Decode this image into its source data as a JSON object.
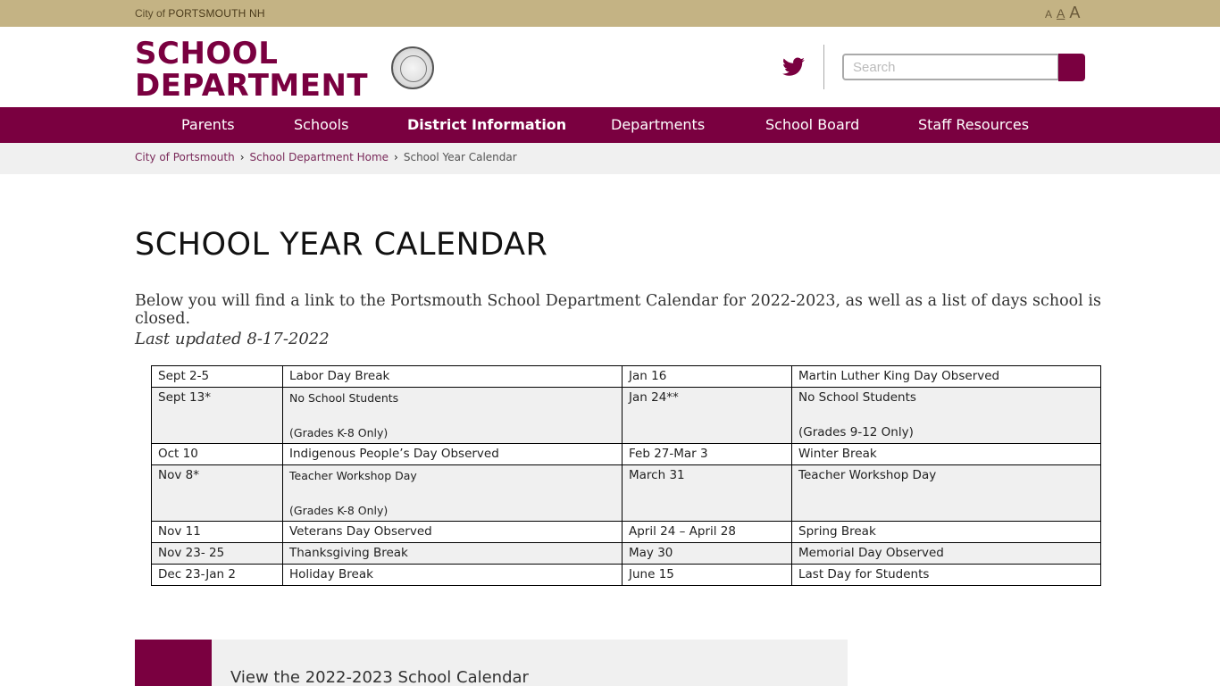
{
  "topbar": {
    "city_prefix": "City of",
    "city_name": "PORTSMOUTH NH",
    "font_sizes": [
      "A",
      "A",
      "A"
    ]
  },
  "header": {
    "logo_line1": "SCHOOL",
    "logo_line2": "DEPARTMENT",
    "search_placeholder": "Search"
  },
  "nav": {
    "items": [
      {
        "label": "Parents"
      },
      {
        "label": "Schools"
      },
      {
        "label": "District Information"
      },
      {
        "label": "Departments"
      },
      {
        "label": "School Board"
      },
      {
        "label": "Staff Resources"
      }
    ]
  },
  "breadcrumb": {
    "items": [
      "City of Portsmouth",
      "School Department Home",
      "School Year Calendar"
    ]
  },
  "content": {
    "title": "SCHOOL YEAR CALENDAR",
    "intro": "Below you will find a link to the Portsmouth School Department Calendar for 2022-2023, as well as a list of days school is closed.",
    "updated": "Last updated 8-17-2022"
  },
  "calendar": {
    "rows": [
      {
        "d1": "Sept 2-5",
        "e1": "Labor Day Break",
        "e1_sub": "",
        "d2": "Jan 16",
        "e2": "Martin Luther King Day Observed",
        "e2_sub": ""
      },
      {
        "d1": "Sept 13*",
        "e1": "No School Students",
        "e1_sub": "(Grades K-8 Only)",
        "d2": "Jan 24**",
        "e2": "No School Students",
        "e2_sub": "(Grades 9-12 Only)"
      },
      {
        "d1": "Oct 10",
        "e1": "Indigenous People’s Day Observed",
        "e1_sub": "",
        "d2": "Feb 27-Mar 3",
        "e2": "Winter Break",
        "e2_sub": ""
      },
      {
        "d1": "Nov 8*",
        "e1": "Teacher Workshop Day",
        "e1_sub": "(Grades K-8 Only)",
        "d2": "March 31",
        "e2": "Teacher Workshop Day",
        "e2_sub": ""
      },
      {
        "d1": "Nov 11",
        "e1": "Veterans Day Observed",
        "e1_sub": "",
        "d2": "April 24 – April 28",
        "e2": "Spring Break",
        "e2_sub": ""
      },
      {
        "d1": "Nov 23- 25",
        "e1": "Thanksgiving Break",
        "e1_sub": "",
        "d2": "May 30",
        "e2": "Memorial Day Observed",
        "e2_sub": ""
      },
      {
        "d1": "Dec 23-Jan 2",
        "e1": "Holiday Break",
        "e1_sub": "",
        "d2": "June 15",
        "e2": "Last Day for Students",
        "e2_sub": ""
      }
    ]
  },
  "card": {
    "label": "View the 2022-2023 School Calendar"
  },
  "colors": {
    "brand": "#7a0040",
    "topbar": "#c4b384"
  },
  "icons": {
    "social": "twitter-icon",
    "search": "search-icon"
  }
}
